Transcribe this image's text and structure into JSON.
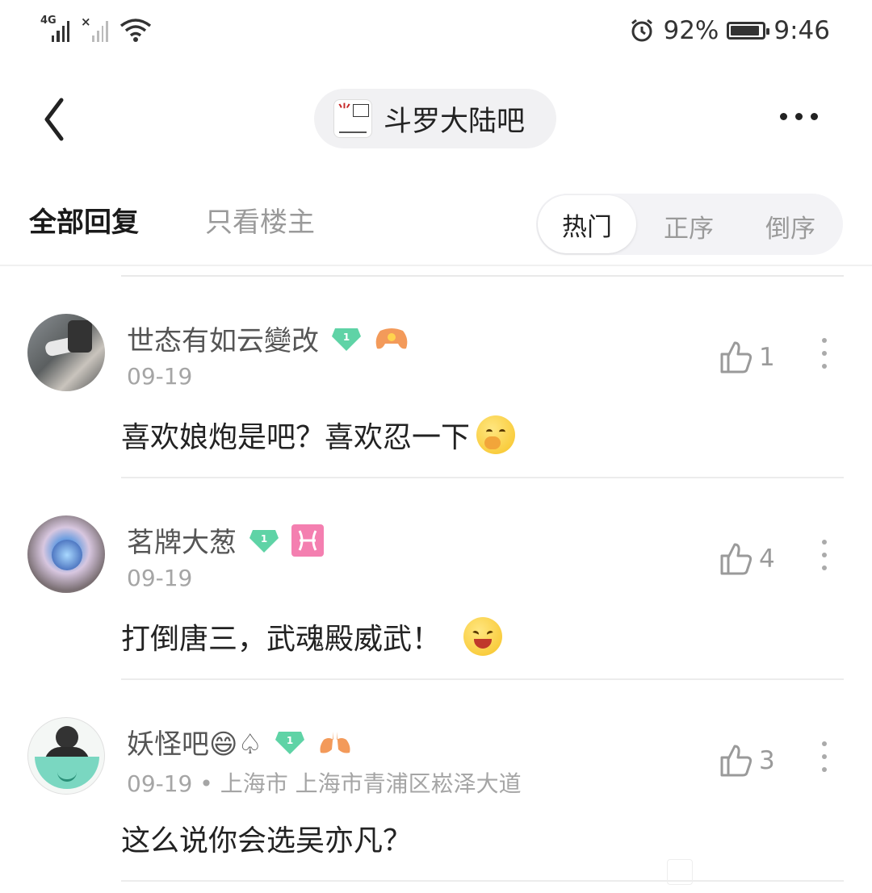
{
  "status_bar": {
    "network_label": "4G",
    "battery_percent": "92%",
    "battery_level": 0.92,
    "time": "9:46"
  },
  "nav": {
    "forum_name": "斗罗大陆吧"
  },
  "tabs": {
    "all_replies": "全部回复",
    "op_only": "只看楼主"
  },
  "sort": {
    "hot": "热门",
    "ascending": "正序",
    "descending": "倒序",
    "selected": "热门"
  },
  "comments": [
    {
      "username": "世态有如云變改",
      "level": "1",
      "date": "09-19",
      "location": "",
      "content": "喜欢娘炮是吧？喜欢忍一下",
      "likes": "1",
      "badge": "gamepad-icon",
      "emoji": "cover-mouth-emoji"
    },
    {
      "username": "茗牌大葱",
      "level": "1",
      "date": "09-19",
      "location": "",
      "content": "打倒唐三，武魂殿威武！",
      "likes": "4",
      "badge": "pisces-icon",
      "emoji": "laughing-emoji"
    },
    {
      "username": "妖怪吧😄♤",
      "level": "1",
      "date": "09-19",
      "location": "上海市 上海市青浦区崧泽大道",
      "content": "这么说你会选吴亦凡？",
      "likes": "3",
      "badge": "lungs-icon",
      "emoji": ""
    }
  ],
  "colors": {
    "level_badge": "#5fd3a6",
    "pisces_badge": "#f47fb0",
    "accent_orange": "#f39a5a",
    "muted_text": "#a5a5a5"
  }
}
